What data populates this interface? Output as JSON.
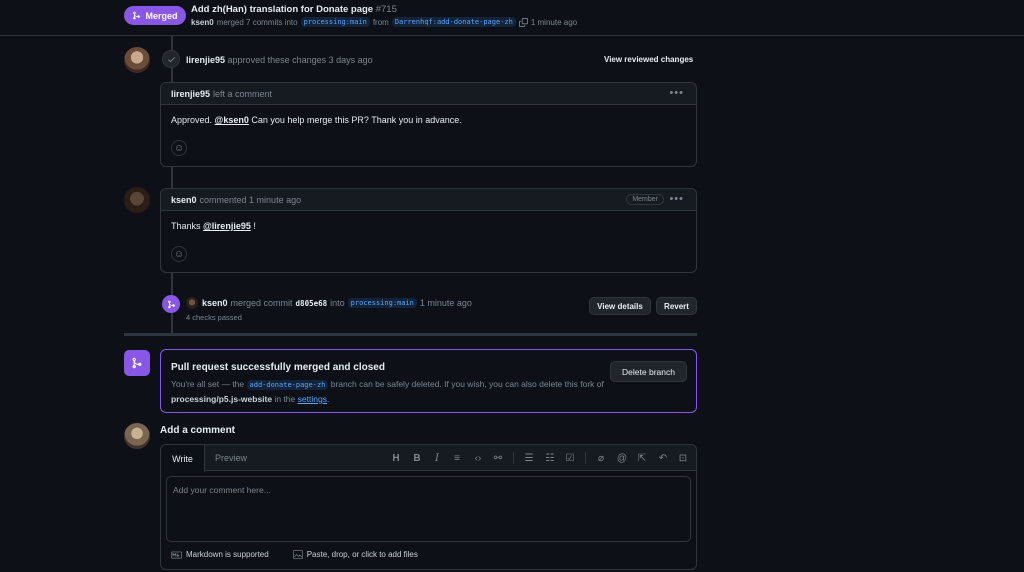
{
  "header": {
    "status_badge": "Merged",
    "title": "Add zh(Han) translation for Donate page",
    "number": "#715",
    "author": "ksen0",
    "merged_text": "merged 7 commits into",
    "base_branch": "processing:main",
    "from_text": "from",
    "head_branch": "Darrenhqf:add-donate-page-zh",
    "time": "1 minute ago"
  },
  "approval": {
    "user": "lirenjie95",
    "text": "approved these changes 3 days ago",
    "link": "View reviewed changes"
  },
  "comment1": {
    "user": "lirenjie95",
    "action": "left a comment",
    "body_prefix": "Approved.",
    "mention": "@ksen0",
    "body_suffix": "Can you help merge this PR? Thank you in advance."
  },
  "comment2": {
    "user": "ksen0",
    "action": "commented 1 minute ago",
    "badge": "Member",
    "body_prefix": "Thanks",
    "mention": "@lirenjie95",
    "body_suffix": "!"
  },
  "merge_event": {
    "user": "ksen0",
    "text1": "merged commit",
    "commit": "d805e68",
    "text2": "into",
    "branch": "processing:main",
    "time": "1 minute ago",
    "checks": "4 checks passed",
    "view_details": "View details",
    "revert": "Revert"
  },
  "merge_box": {
    "title": "Pull request successfully merged and closed",
    "desc1": "You're all set — the",
    "branch": "add-donate-page-zh",
    "desc2": "branch can be safely deleted. If you wish, you can also delete this fork of",
    "repo": "processing/p5.js-website",
    "desc3": "in the",
    "settings": "settings",
    "desc4": ".",
    "delete_button": "Delete branch"
  },
  "add_comment": {
    "title": "Add a comment",
    "tab_write": "Write",
    "tab_preview": "Preview",
    "placeholder": "Add your comment here...",
    "markdown_note": "Markdown is supported",
    "files_note": "Paste, drop, or click to add files",
    "toolbar": [
      "heading-icon",
      "bold-icon",
      "italic-icon",
      "quote-icon",
      "code-icon",
      "link-icon",
      "ordered-list-icon",
      "unordered-list-icon",
      "task-list-icon",
      "attach-icon",
      "mention-icon",
      "reference-icon",
      "undo-icon",
      "fullscreen-icon"
    ]
  },
  "colors": {
    "merged": "#8957e5",
    "link": "#58a6ff",
    "background": "#0d1117",
    "border": "#30363d"
  }
}
